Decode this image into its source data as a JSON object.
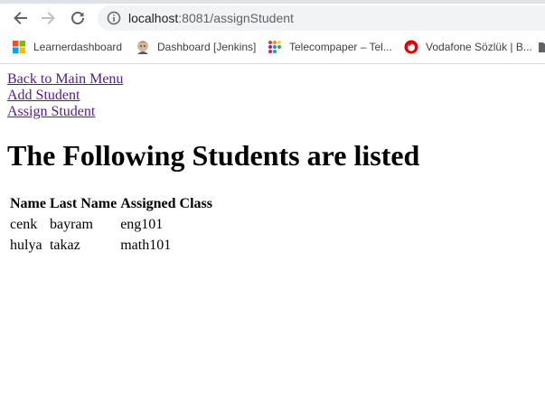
{
  "browser": {
    "url_host": "localhost",
    "url_rest": ":8081/assignStudent",
    "bookmarks": [
      {
        "label": "Learnerdashboard",
        "icon": "microsoft-icon"
      },
      {
        "label": "Dashboard [Jenkins]",
        "icon": "jenkins-icon"
      },
      {
        "label": "Telecompaper – Tel...",
        "icon": "telecompaper-icon"
      },
      {
        "label": "Vodafone Sözlük | B...",
        "icon": "vodafone-icon"
      }
    ]
  },
  "page": {
    "links": [
      "Back to Main Menu",
      "Add Student",
      "Assign Student"
    ],
    "heading": "The Following Students are listed",
    "table": {
      "headers": [
        "Name",
        "Last Name",
        "Assigned Class"
      ],
      "rows": [
        [
          "cenk",
          "bayram",
          "eng101"
        ],
        [
          "hulya",
          "takaz",
          "math101"
        ]
      ]
    }
  },
  "colors": {
    "link_visited": "#551a8b",
    "omnibox_bg": "#f1f3f4",
    "vodafone_red": "#e60000"
  }
}
